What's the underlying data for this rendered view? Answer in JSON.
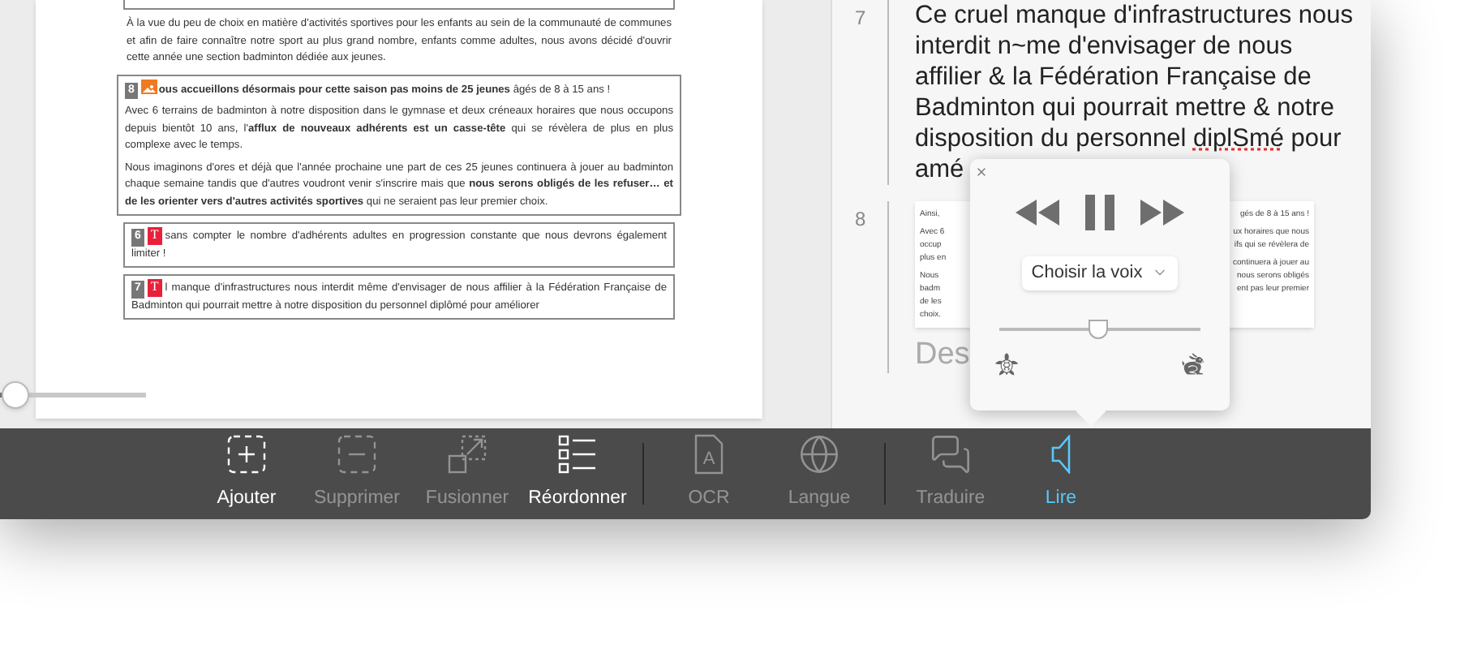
{
  "document_page": {
    "top_paragraph": "À la vue du peu de choix en matière d'activités sportives pour les enfants au sein de la communauté de communes et afin de faire connaître notre sport au plus grand nombre, enfants comme adultes, nous avons décidé d'ouvrir cette année une section badminton dédiée aux jeunes.",
    "blocks": [
      {
        "number": "8",
        "kind": "image",
        "paragraphs": [
          "**ous accueillons désormais pour cette saison pas moins de 25 jeunes** âgés de 8 à 15 ans !",
          "Avec 6 terrains de badminton à notre disposition dans le gymnase et deux créneaux horaires que nous occupons depuis bientôt 10 ans, l'**afflux de nouveaux adhérents est un casse-tête** qui se révèlera de plus en plus complexe avec le temps.",
          "Nous imaginons d'ores et déjà que l'année prochaine une part de ces 25 jeunes continuera à jouer au badminton chaque semaine tandis que d'autres voudront venir s'inscrire mais que **nous serons obligés de les refuser… et de les orienter vers d'autres activités sportives** qui ne seraient pas leur premier choix."
        ]
      },
      {
        "number": "6",
        "kind": "text",
        "badge": "T",
        "paragraphs": [
          "sans compter le nombre d'adhérents adultes en progression constante que nous devrons également limiter !"
        ]
      },
      {
        "number": "7",
        "kind": "text",
        "badge": "T",
        "paragraphs": [
          "l manque d'infrastructures nous interdit même d'envisager de nous affilier à la Fédération Française de Badminton qui pourrait mettre à notre disposition du personnel diplômé pour améliorer"
        ]
      }
    ]
  },
  "zoom_slider": {
    "level": 0.1
  },
  "recognized_pane": {
    "sections": [
      {
        "number": "7",
        "segments": [
          {
            "text": "Ce cruel manque d'infrastructures nous interdit n~me d'envisager de nous affilier & la Fédération Française de Badminton qui pourrait mettre & notre disposition du personnel ",
            "misspelled": false
          },
          {
            "text": "diplSmé",
            "misspelled": true
          },
          {
            "text": " pour amé",
            "misspelled": false
          }
        ]
      },
      {
        "number": "8",
        "thumbnail": {
          "left": [
            [
              "Ainsi,"
            ],
            [
              "Avec 6",
              "occup",
              "plus en"
            ],
            [
              "Nous",
              "badm",
              "de les",
              "choix."
            ]
          ],
          "right": [
            [
              "gés de 8 à 15 ans !"
            ],
            [
              "ux horaires que nous",
              "ifs qui se révèlera de"
            ],
            [
              "continuera à jouer au",
              "nous serons obligés",
              "ent pas leur premier"
            ]
          ]
        },
        "heading": "Des"
      }
    ]
  },
  "read_popover": {
    "voice_select": "Choisir la voix",
    "speed": {
      "level": 0.49
    }
  },
  "toolbar": {
    "groups": [
      [
        {
          "label": "Ajouter",
          "disabled": false,
          "selected": false
        },
        {
          "label": "Supprimer",
          "disabled": true,
          "selected": false
        },
        {
          "label": "Fusionner",
          "disabled": true,
          "selected": false
        },
        {
          "label": "Réordonner",
          "disabled": false,
          "selected": false
        }
      ],
      [
        {
          "label": "OCR",
          "glyph": "A",
          "disabled": true,
          "selected": false
        },
        {
          "label": "Langue",
          "disabled": true,
          "selected": false
        }
      ],
      [
        {
          "label": "Traduire",
          "disabled": true,
          "selected": false
        },
        {
          "label": "Lire",
          "disabled": false,
          "selected": true
        }
      ]
    ]
  }
}
